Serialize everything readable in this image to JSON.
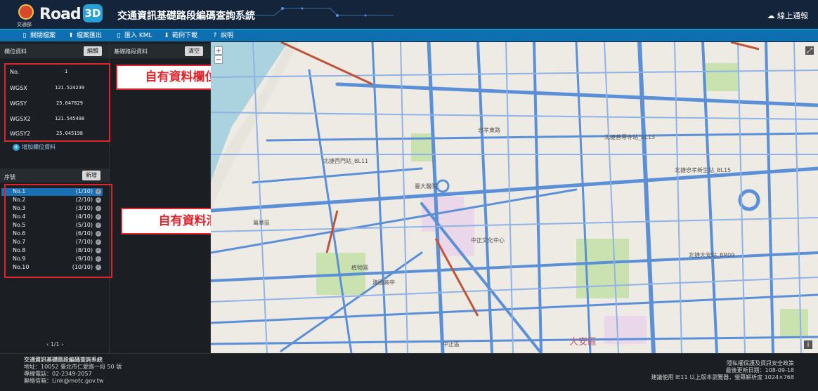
{
  "header": {
    "org_name": "交通部",
    "brand": "Road",
    "brand_badge": "3D",
    "title": "交通資訊基礎路段編碼查詢系統",
    "report_label": "線上通報",
    "report_icon": "cloud-icon"
  },
  "menubar": [
    {
      "icon": "file-icon",
      "label": "關閉檔案"
    },
    {
      "icon": "upload-icon",
      "label": "檔案匯出"
    },
    {
      "icon": "file-icon",
      "label": "匯入 KML"
    },
    {
      "icon": "download-icon",
      "label": "範例下載"
    },
    {
      "icon": "help-icon",
      "label": "說明"
    }
  ],
  "fields_panel": {
    "title": "欄位資料",
    "edit_label": "編輯",
    "fields": [
      {
        "key": "No.",
        "value": "1"
      },
      {
        "key": "WGSX",
        "value": "121.524239"
      },
      {
        "key": "WGSY",
        "value": "25.047829"
      },
      {
        "key": "WGSX2",
        "value": "121.545498"
      },
      {
        "key": "WGSY2",
        "value": "25.045198"
      }
    ],
    "add_field_label": "增加欄位資料"
  },
  "list_panel": {
    "title": "序號",
    "add_label": "新增",
    "selected_index": 0,
    "items": [
      {
        "label": "No.1",
        "count": "(1/10)"
      },
      {
        "label": "No.2",
        "count": "(2/10)"
      },
      {
        "label": "No.3",
        "count": "(3/10)"
      },
      {
        "label": "No.4",
        "count": "(4/10)"
      },
      {
        "label": "No.5",
        "count": "(5/10)"
      },
      {
        "label": "No.6",
        "count": "(6/10)"
      },
      {
        "label": "No.7",
        "count": "(7/10)"
      },
      {
        "label": "No.8",
        "count": "(8/10)"
      },
      {
        "label": "No.9",
        "count": "(9/10)"
      },
      {
        "label": "No.10",
        "count": "(10/10)"
      }
    ],
    "pager": "1/1"
  },
  "segment_panel": {
    "title": "基礎路段資料",
    "clear_label": "清空"
  },
  "annotations": {
    "fields_callout": "自有資料欄位內容",
    "list_callout": "自有資料清單"
  },
  "map": {
    "zoom_in": "+",
    "zoom_out": "−",
    "district_label": "大安區",
    "labels": [
      "北捷西門站_BL11",
      "北捷忠孝新生站_BL15",
      "北捷善導寺站_BL13",
      "臺大醫院",
      "中正文化中心",
      "建國高中",
      "植物園",
      "忠孝東路",
      "北捷大安站_BR09",
      "萬華區",
      "中正區"
    ],
    "colors": {
      "road": "#5b8fd6",
      "highway": "#c0543a",
      "park": "#c9e2b0",
      "water": "#aad3df",
      "campus": "#ead7ea"
    }
  },
  "footer": {
    "system_name": "交通資訊基礎路段編碼查詢系統",
    "address": "地址：10052 臺北市仁愛路一段 50 號",
    "phone": "專線電話：02-2349-2057",
    "email": "聯絡信箱：Link@motc.gov.tw",
    "privacy": "隱私權保護及資訊安全政策",
    "updated": "最後更新日期：108-09-18",
    "browser_note": "建議使用 IE11 以上版本瀏覽器，螢幕解析度 1024×768"
  }
}
